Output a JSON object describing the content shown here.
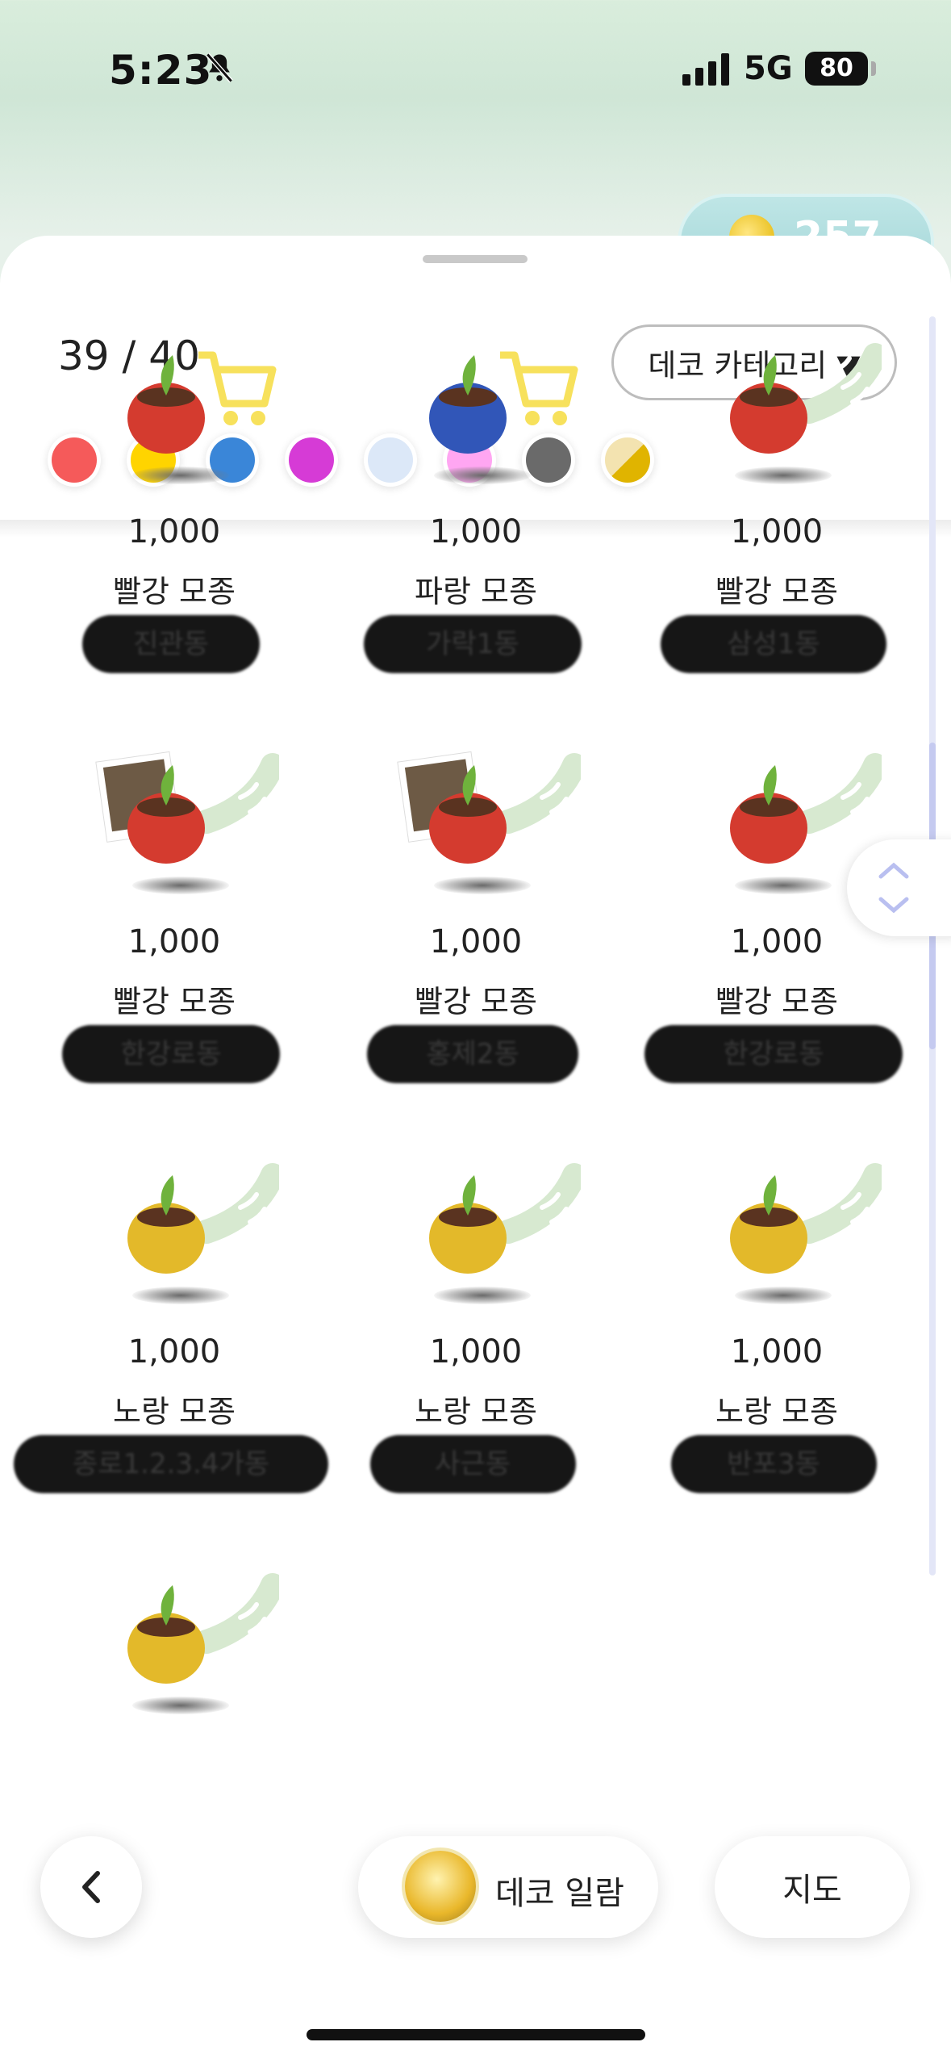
{
  "status_bar": {
    "time": "5:23",
    "network": "5G",
    "battery": "80"
  },
  "coin": {
    "count": "257"
  },
  "header": {
    "counter": "39 / 40",
    "category_label": "데코 카테고리 ▼"
  },
  "colors": [
    "#f55a5a",
    "#ffd400",
    "#3a86d8",
    "#d63bd6",
    "#dce8f8",
    "#ffa6f2",
    "#6a6a6a",
    "#e0b400"
  ],
  "items": [
    {
      "price": "1,000",
      "name": "빨강 모종",
      "location": "진관동",
      "pot": "#d43b2f",
      "tag": "cart",
      "photo": false
    },
    {
      "price": "1,000",
      "name": "파랑 모종",
      "location": "가락1동",
      "pot": "#3156b8",
      "tag": "cart",
      "photo": false
    },
    {
      "price": "1,000",
      "name": "빨강 모종",
      "location": "삼성1동",
      "pot": "#d43b2f",
      "tag": "trail",
      "photo": false
    },
    {
      "price": "1,000",
      "name": "빨강 모종",
      "location": "한강로동",
      "pot": "#d43b2f",
      "tag": "trail",
      "photo": true
    },
    {
      "price": "1,000",
      "name": "빨강 모종",
      "location": "홍제2동",
      "pot": "#d43b2f",
      "tag": "trail",
      "photo": true
    },
    {
      "price": "1,000",
      "name": "빨강 모종",
      "location": "한강로동",
      "pot": "#d43b2f",
      "tag": "trail",
      "photo": false
    },
    {
      "price": "1,000",
      "name": "노랑 모종",
      "location": "종로1.2.3.4가동",
      "pot": "#e3b92a",
      "tag": "trail",
      "photo": false
    },
    {
      "price": "1,000",
      "name": "노랑 모종",
      "location": "사근동",
      "pot": "#e3b92a",
      "tag": "trail",
      "photo": false
    },
    {
      "price": "1,000",
      "name": "노랑 모종",
      "location": "반포3동",
      "pot": "#e3b92a",
      "tag": "trail",
      "photo": false
    },
    {
      "price": "",
      "name": "",
      "location": "",
      "pot": "#e3b92a",
      "tag": "trail",
      "photo": false
    }
  ],
  "bottom": {
    "deco_label": "데코 일람",
    "map_label": "지도"
  }
}
